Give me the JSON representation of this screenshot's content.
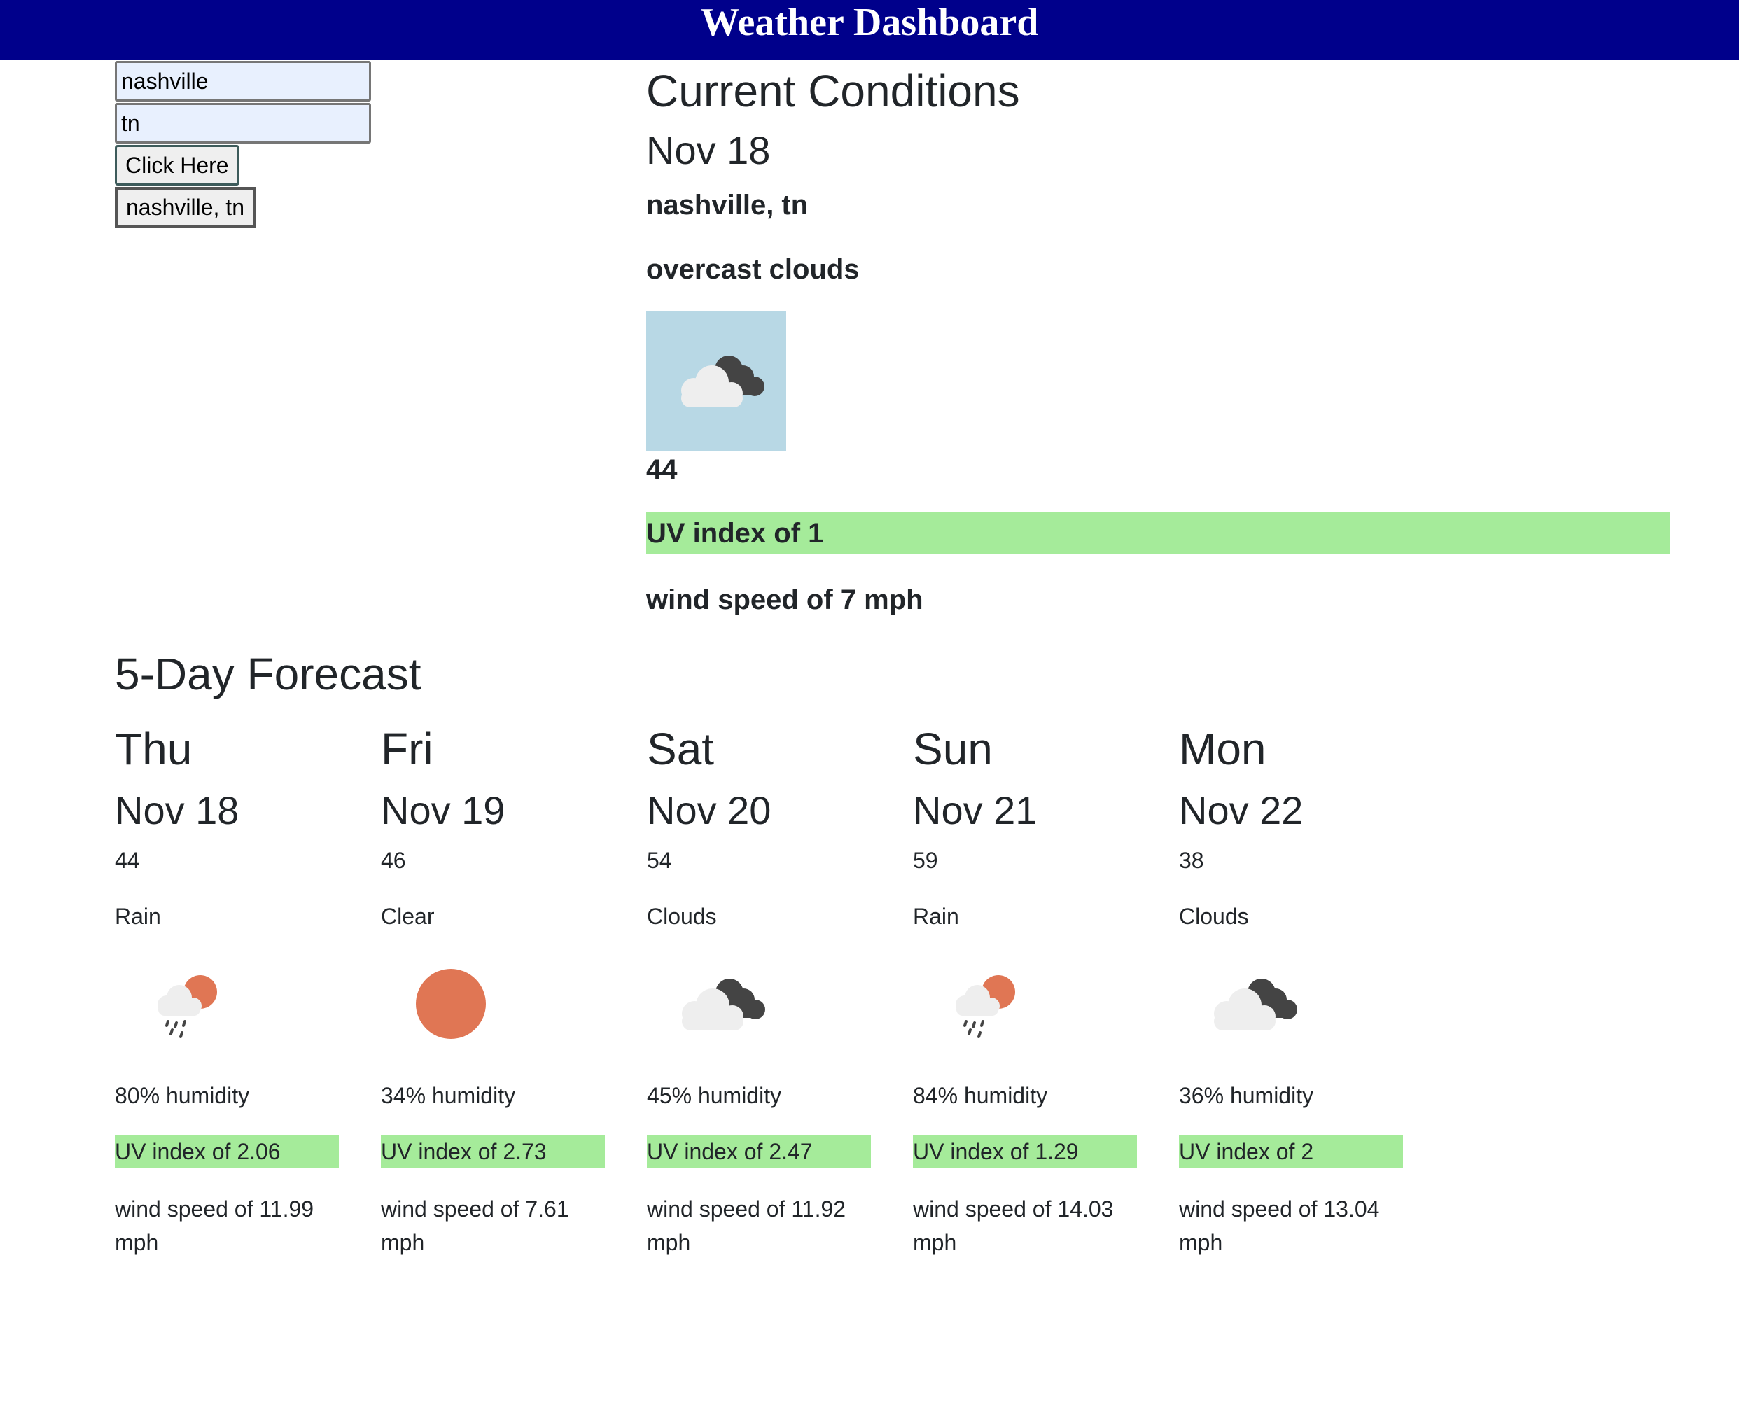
{
  "header": {
    "title": "Weather Dashboard"
  },
  "search": {
    "city_value": "nashville",
    "state_value": "tn",
    "submit_label": "Click Here",
    "history": [
      "nashville, tn"
    ]
  },
  "current": {
    "heading": "Current Conditions",
    "date": "Nov 18",
    "location": "nashville, tn",
    "description": "overcast clouds",
    "icon": "broken-clouds-icon",
    "temp": "44",
    "uv": "UV index of 1",
    "wind": "wind speed of 7 mph"
  },
  "forecast": {
    "heading": "5-Day Forecast",
    "days": [
      {
        "dow": "Thu",
        "date": "Nov 18",
        "temp": "44",
        "desc": "Rain",
        "icon": "rain-icon",
        "humidity": "80% humidity",
        "uv": "UV index of 2.06",
        "wind": "wind speed of 11.99 mph"
      },
      {
        "dow": "Fri",
        "date": "Nov 19",
        "temp": "46",
        "desc": "Clear",
        "icon": "sun-icon",
        "humidity": "34% humidity",
        "uv": "UV index of 2.73",
        "wind": "wind speed of 7.61 mph"
      },
      {
        "dow": "Sat",
        "date": "Nov 20",
        "temp": "54",
        "desc": "Clouds",
        "icon": "broken-clouds-icon",
        "humidity": "45% humidity",
        "uv": "UV index of 2.47",
        "wind": "wind speed of 11.92 mph"
      },
      {
        "dow": "Sun",
        "date": "Nov 21",
        "temp": "59",
        "desc": "Rain",
        "icon": "rain-icon",
        "humidity": "84% humidity",
        "uv": "UV index of 1.29",
        "wind": "wind speed of 14.03 mph"
      },
      {
        "dow": "Mon",
        "date": "Nov 22",
        "temp": "38",
        "desc": "Clouds",
        "icon": "broken-clouds-icon",
        "humidity": "36% humidity",
        "uv": "UV index of 2",
        "wind": "wind speed of 13.04 mph"
      }
    ]
  },
  "colors": {
    "header_bg": "#00008b",
    "uv_low": "#a5eb9a",
    "icon_bg": "#b8d8e5",
    "sun": "#e07654",
    "cloud_light": "#eeeeee",
    "cloud_dark": "#444444"
  }
}
